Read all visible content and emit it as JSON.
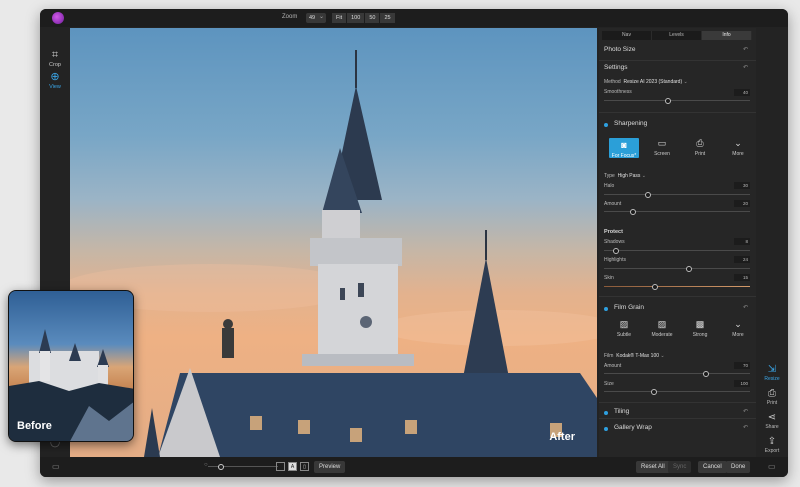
{
  "topbar": {
    "zoom_label": "Zoom",
    "zoom_value": "49",
    "zoom_presets": [
      "Fit",
      "100",
      "50",
      "25"
    ]
  },
  "left_tools": [
    {
      "label": "Crop",
      "icon": "crop-icon"
    },
    {
      "label": "View",
      "icon": "view-icon",
      "active": true
    }
  ],
  "canvas": {
    "after_label": "After",
    "before_label": "Before"
  },
  "panel": {
    "tabs": [
      "Nav",
      "Levels",
      "Info"
    ],
    "selected_tab": "Info",
    "photo_size": "Photo Size",
    "settings": "Settings",
    "method_label": "Method",
    "method_value": "Resize AI 2023 (Standard)",
    "smoothness_label": "Smoothness",
    "smoothness_value": "40",
    "smoothness_level": 0.44,
    "sharpening": {
      "title": "Sharpening",
      "presets": [
        {
          "label": "For Focus*",
          "icon": "camera-icon",
          "selected": true
        },
        {
          "label": "Screen",
          "icon": "monitor-icon"
        },
        {
          "label": "Print",
          "icon": "printer-icon"
        },
        {
          "label": "More",
          "icon": "more-chevron-icon"
        }
      ],
      "type_label": "Type",
      "type_value": "High Pass",
      "halo_label": "Halo",
      "halo_value": "30",
      "halo_level": 0.3,
      "amount_label": "Amount",
      "amount_value": "20",
      "amount_level": 0.2,
      "protect_label": "Protect",
      "shadows_label": "Shadows",
      "shadows_value": "8",
      "shadows_level": 0.08,
      "highlights_label": "Highlights",
      "highlights_value": "24",
      "highlights_level": 0.58,
      "skin_label": "Skin",
      "skin_value": "15",
      "skin_level": 0.35
    },
    "film_grain": {
      "title": "Film Grain",
      "presets": [
        {
          "label": "Subtle",
          "icon": "grain-subtle-icon"
        },
        {
          "label": "Moderate",
          "icon": "grain-moderate-icon"
        },
        {
          "label": "Strong",
          "icon": "grain-strong-icon"
        },
        {
          "label": "More",
          "icon": "more-chevron-icon"
        }
      ],
      "film_label": "Film",
      "film_value": "Kodak® T-Max 100",
      "amount_label": "Amount",
      "amount_value": "70",
      "amount_level": 0.7,
      "size_label": "Size",
      "size_value": "100",
      "size_level": 0.34
    },
    "tiling": "Tiling",
    "gallery_wrap": "Gallery Wrap"
  },
  "right_rail": [
    {
      "label": "Resize",
      "icon": "resize-icon",
      "active": true
    },
    {
      "label": "Print",
      "icon": "printer-icon"
    },
    {
      "label": "Share",
      "icon": "share-icon"
    },
    {
      "label": "Export",
      "icon": "export-icon"
    }
  ],
  "bottombar": {
    "preview_label": "Preview",
    "reset_all": "Reset All",
    "sync": "Sync",
    "cancel": "Cancel",
    "done": "Done"
  },
  "colors": {
    "accent": "#2ea0e0",
    "window_bg": "#232323",
    "panel_bg": "#262626"
  }
}
